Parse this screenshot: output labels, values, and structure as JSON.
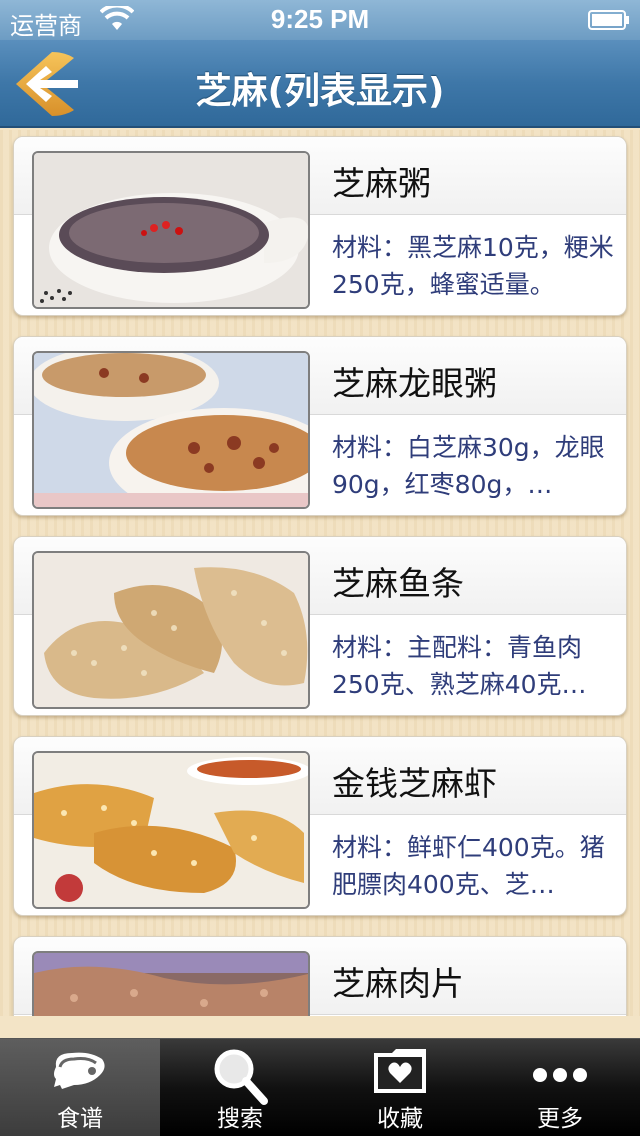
{
  "status_bar": {
    "carrier": "运营商",
    "time": "9:25 PM"
  },
  "nav": {
    "title": "芝麻(列表显示)",
    "back_icon": "back-arrow-icon"
  },
  "recipes": [
    {
      "title": "芝麻粥",
      "desc": "材料：黑芝麻10克，粳米250克，蜂蜜适量。"
    },
    {
      "title": "芝麻龙眼粥",
      "desc": "材料：白芝麻30g，龙眼90g，红枣80g，…"
    },
    {
      "title": "芝麻鱼条",
      "desc": "材料：主配料：青鱼肉250克、熟芝麻40克…"
    },
    {
      "title": "金钱芝麻虾",
      "desc": "材料：鲜虾仁400克。猪肥膘肉400克、芝…"
    },
    {
      "title": "芝麻肉片",
      "desc": ""
    }
  ],
  "tabs": [
    {
      "label": "食谱",
      "icon": "meat-icon",
      "active": true
    },
    {
      "label": "搜索",
      "icon": "search-icon",
      "active": false
    },
    {
      "label": "收藏",
      "icon": "favorites-folder-icon",
      "active": false
    },
    {
      "label": "更多",
      "icon": "more-dots-icon",
      "active": false
    }
  ]
}
